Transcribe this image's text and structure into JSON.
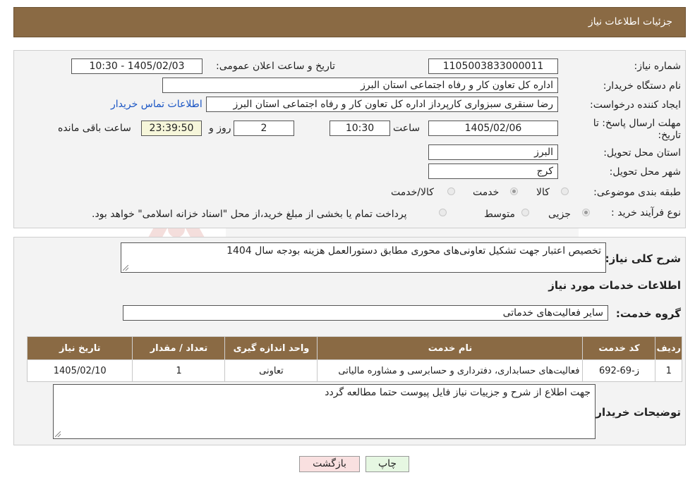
{
  "header": {
    "title": "جزئیات اطلاعات نیاز"
  },
  "fields": {
    "need_number_label": "شماره نیاز:",
    "need_number": "1105003833000011",
    "announce_label": "تاریخ و ساعت اعلان عمومی:",
    "announce_value": "1405/02/03 - 10:30",
    "buyer_label": "نام دستگاه خریدار:",
    "buyer_value": "اداره کل تعاون  کار و رفاه اجتماعی استان البرز",
    "creator_label": "ایجاد کننده درخواست:",
    "creator_value": "رضا سنقری سبزواری کارپرداز اداره کل تعاون  کار و رفاه اجتماعی استان البرز",
    "contact_link": "اطلاعات تماس خریدار",
    "deadline_label": "مهلت ارسال پاسخ: تا تاریخ:",
    "deadline_date": "1405/02/06",
    "time_label": "ساعت",
    "deadline_time": "10:30",
    "days_value": "2",
    "days_label": "روز و",
    "remaining_time": "23:39:50",
    "remaining_label": "ساعت باقی مانده",
    "province_label": "استان محل تحویل:",
    "province_value": "البرز",
    "city_label": "شهر محل تحویل:",
    "city_value": "کرج",
    "category_label": "طبقه بندی موضوعی:",
    "category_options": [
      "کالا",
      "خدمت",
      "کالا/خدمت"
    ],
    "purchase_type_label": "نوع فرآیند خرید :",
    "purchase_type_options": [
      "جزیی",
      "متوسط"
    ],
    "purchase_note": "پرداخت تمام یا بخشی از مبلغ خرید،از محل \"اسناد خزانه اسلامی\" خواهد بود."
  },
  "summary": {
    "label": "شرح کلی نیاز:",
    "value": "تخصیص اعتبار جهت تشکیل تعاونی‌های محوری  مطابق دستورالعمل هزینه بودجه سال 1404"
  },
  "services": {
    "section_title": "اطلاعات خدمات مورد نیاز",
    "group_label": "گروه خدمت:",
    "group_value": "سایر فعالیت‌های خدماتی",
    "columns": [
      "ردیف",
      "کد خدمت",
      "نام خدمت",
      "واحد اندازه گیری",
      "تعداد / مقدار",
      "تاریخ نیاز"
    ],
    "rows": [
      [
        "1",
        "ز-69-692",
        "فعالیت‌های حسابداری، دفترداری و حسابرسی و مشاوره مالیاتی",
        "تعاونی",
        "1",
        "1405/02/10"
      ]
    ]
  },
  "buyer_notes": {
    "label": "توضیحات خریدار:",
    "value": "جهت اطلاع از شرح و جزییات نیاز فایل پیوست حتما مطالعه گردد"
  },
  "buttons": {
    "print": "چاپ",
    "back": "بازگشت"
  },
  "colors": {
    "header_bg": "#8a6a44",
    "print_btn": "#e6f7e2",
    "back_btn": "#f9e0e0",
    "link": "#1a55c4"
  }
}
